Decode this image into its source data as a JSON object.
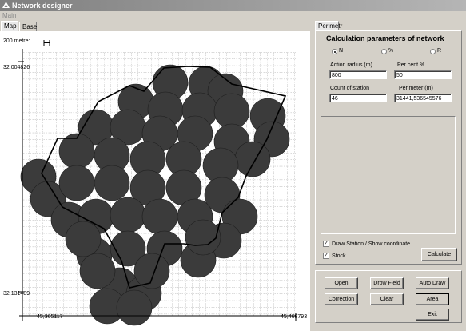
{
  "window": {
    "title": "Network designer"
  },
  "menu": {
    "main": "Main"
  },
  "left_tabs": [
    "Map",
    "Base"
  ],
  "right_tabs": [
    "Perimetr"
  ],
  "map": {
    "scale_label": "200 metre:",
    "y_top": "32,004826",
    "y_bottom": "32,131489",
    "x_left": "45,365117",
    "x_right": "45,468793"
  },
  "calc": {
    "title": "Calculation parameters of network",
    "radio_n": "N",
    "radio_pct": "%",
    "radio_r": "R",
    "radio_selected": "N",
    "action_radius_label": "Action radius (m)",
    "action_radius_value": "800",
    "per_cent_label": "Per cent  %",
    "per_cent_value": "50",
    "count_label": "Count of station",
    "count_value": "46",
    "perimeter_label": "Perimeter  (m)",
    "perimeter_value": "31441,536545576",
    "draw_station_label": "Draw Station / Show coordinate",
    "draw_station_checked": true,
    "stock_label": "Stock",
    "stock_checked": true,
    "calculate_label": "Calculate"
  },
  "buttons": {
    "open": "Open",
    "drow_field": "Drow Field",
    "auto_draw": "Auto Draw",
    "correction": "Correction",
    "clear": "Clear",
    "area": "Area",
    "exit": "Exit"
  }
}
